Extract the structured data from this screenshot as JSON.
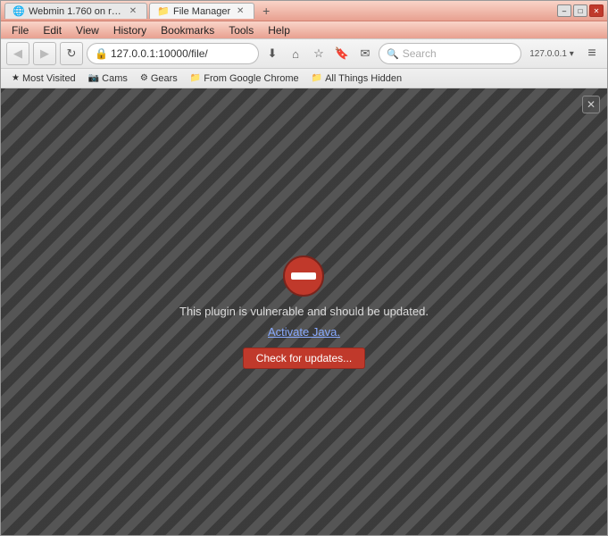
{
  "window": {
    "title": "File Manager",
    "controls": {
      "minimize": "–",
      "maximize": "□",
      "close": "✕"
    }
  },
  "tabs": [
    {
      "id": "tab-webmin",
      "label": "Webmin 1.760 on raspberr...",
      "favicon": "🌐",
      "active": false
    },
    {
      "id": "tab-filemanager",
      "label": "File Manager",
      "favicon": "📁",
      "active": true
    }
  ],
  "new_tab_label": "+",
  "menubar": {
    "items": [
      "File",
      "Edit",
      "View",
      "History",
      "Bookmarks",
      "Tools",
      "Help"
    ]
  },
  "navbar": {
    "back_label": "◀",
    "forward_label": "▶",
    "reload_label": "↻",
    "home_label": "⌂",
    "url": "127.0.0.1:10000/file/",
    "url_icon": "🔒",
    "search_placeholder": "Search",
    "icons": {
      "download": "⬇",
      "home": "⌂",
      "star_empty": "☆",
      "bookmark": "🔖",
      "send": "✉",
      "profile": "127.0.0.1 ▾",
      "menu": "≡"
    }
  },
  "bookmarks": [
    {
      "label": "Most Visited",
      "icon": "★"
    },
    {
      "label": "Cams",
      "icon": "📷"
    },
    {
      "label": "Gears",
      "icon": "⚙"
    },
    {
      "label": "From Google Chrome",
      "icon": "📁"
    },
    {
      "label": "All Things Hidden",
      "icon": "📁"
    }
  ],
  "content": {
    "plugin_message": "This plugin is vulnerable and should be updated.",
    "activate_label": "Activate Java.",
    "check_updates_label": "Check for updates...",
    "close_icon": "✕"
  }
}
